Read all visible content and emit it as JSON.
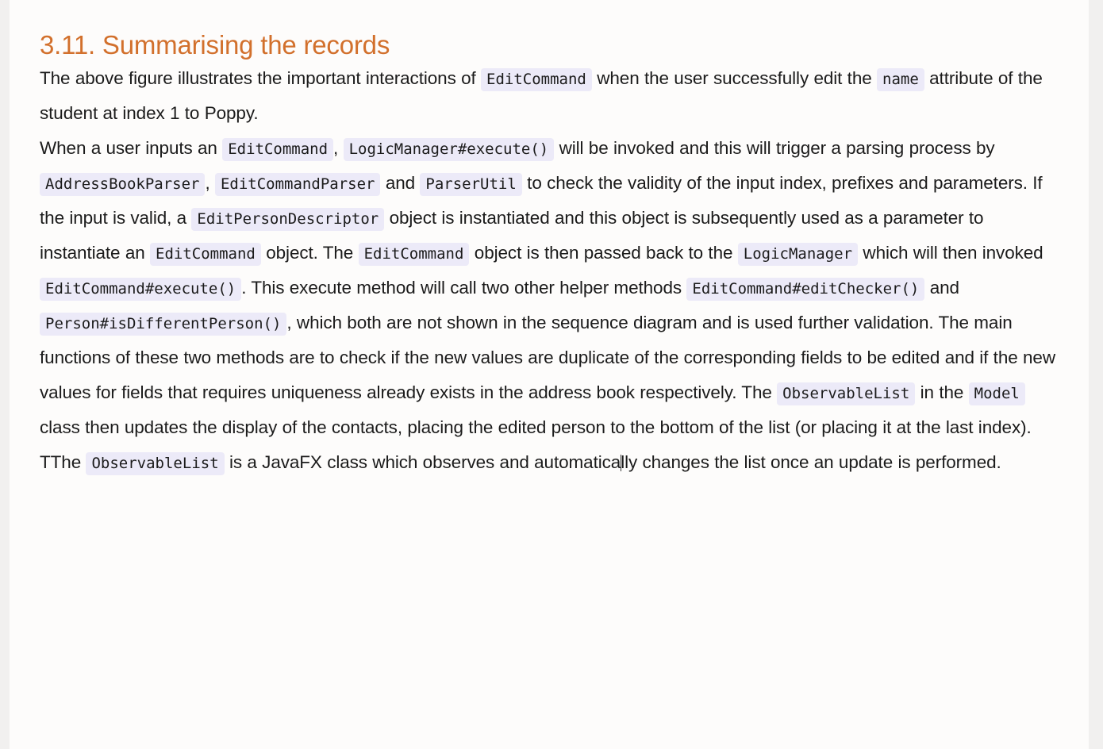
{
  "document": {
    "heading": "3.11. Summarising the records",
    "heading_color": "#d2702c",
    "code_bg_color": "#eceaf8",
    "body_color": "#1b1b1b",
    "page_bg_color": "#fdfcfb"
  },
  "paragraph1": {
    "t1": "The above figure illustrates the important interactions of",
    "c1": "EditCommand",
    "t2": "when the user successfully edit the",
    "c2": "name",
    "t3": "attribute of the student at index 1 to Poppy."
  },
  "paragraph2": {
    "t1": "When a user inputs an",
    "c1": "EditCommand",
    "t2": ",",
    "c2": "LogicManager#execute()",
    "t3": "will be invoked and this will trigger a parsing process by",
    "c3": "AddressBookParser",
    "t4": ",",
    "c4": "EditCommandParser",
    "t5": "and",
    "c5": "ParserUtil",
    "t6": "to check the validity of the input index, prefixes and parameters. If the input is valid, a",
    "c6": "EditPersonDescriptor",
    "t7": "object is instantiated and this object is subsequently used as a parameter to instantiate an",
    "c7": "EditCommand",
    "t8": "object. The",
    "c8": "EditCommand",
    "t9": "object is then passed back to the",
    "c9": "LogicManager",
    "t10": "which will then invoked",
    "c10": "EditCommand#execute()",
    "t11": ". This execute method will call two other helper methods",
    "c11": "EditCommand#editChecker()",
    "t12": "and",
    "c12": "Person#isDifferentPerson()",
    "t13": ", which both are not shown in the sequence diagram and is used further validation. The main functions of these two methods are to check if the new values are duplicate of the corresponding fields to be edited and if the new values for fields that requires uniqueness already exists in the address book respectively. The",
    "c13": "ObservableList",
    "t14": "in the",
    "c14": "Model",
    "t15": "class then updates the display of the contacts, placing the edited person to the bottom of the list (or placing it at the last index)."
  },
  "paragraph3": {
    "t1": "TThe",
    "c1": "ObservableList",
    "t2": "is a JavaFX class which observes and automatica",
    "t3": "lly changes the list once an update is performed."
  }
}
